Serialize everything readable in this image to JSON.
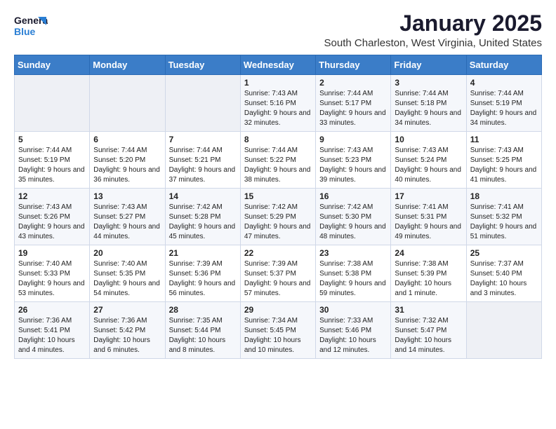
{
  "logo": {
    "line1": "General",
    "line2": "Blue"
  },
  "title": "January 2025",
  "subtitle": "South Charleston, West Virginia, United States",
  "days_of_week": [
    "Sunday",
    "Monday",
    "Tuesday",
    "Wednesday",
    "Thursday",
    "Friday",
    "Saturday"
  ],
  "weeks": [
    [
      {
        "day": "",
        "info": ""
      },
      {
        "day": "",
        "info": ""
      },
      {
        "day": "",
        "info": ""
      },
      {
        "day": "1",
        "info": "Sunrise: 7:43 AM\nSunset: 5:16 PM\nDaylight: 9 hours and 32 minutes."
      },
      {
        "day": "2",
        "info": "Sunrise: 7:44 AM\nSunset: 5:17 PM\nDaylight: 9 hours and 33 minutes."
      },
      {
        "day": "3",
        "info": "Sunrise: 7:44 AM\nSunset: 5:18 PM\nDaylight: 9 hours and 34 minutes."
      },
      {
        "day": "4",
        "info": "Sunrise: 7:44 AM\nSunset: 5:19 PM\nDaylight: 9 hours and 34 minutes."
      }
    ],
    [
      {
        "day": "5",
        "info": "Sunrise: 7:44 AM\nSunset: 5:19 PM\nDaylight: 9 hours and 35 minutes."
      },
      {
        "day": "6",
        "info": "Sunrise: 7:44 AM\nSunset: 5:20 PM\nDaylight: 9 hours and 36 minutes."
      },
      {
        "day": "7",
        "info": "Sunrise: 7:44 AM\nSunset: 5:21 PM\nDaylight: 9 hours and 37 minutes."
      },
      {
        "day": "8",
        "info": "Sunrise: 7:44 AM\nSunset: 5:22 PM\nDaylight: 9 hours and 38 minutes."
      },
      {
        "day": "9",
        "info": "Sunrise: 7:43 AM\nSunset: 5:23 PM\nDaylight: 9 hours and 39 minutes."
      },
      {
        "day": "10",
        "info": "Sunrise: 7:43 AM\nSunset: 5:24 PM\nDaylight: 9 hours and 40 minutes."
      },
      {
        "day": "11",
        "info": "Sunrise: 7:43 AM\nSunset: 5:25 PM\nDaylight: 9 hours and 41 minutes."
      }
    ],
    [
      {
        "day": "12",
        "info": "Sunrise: 7:43 AM\nSunset: 5:26 PM\nDaylight: 9 hours and 43 minutes."
      },
      {
        "day": "13",
        "info": "Sunrise: 7:43 AM\nSunset: 5:27 PM\nDaylight: 9 hours and 44 minutes."
      },
      {
        "day": "14",
        "info": "Sunrise: 7:42 AM\nSunset: 5:28 PM\nDaylight: 9 hours and 45 minutes."
      },
      {
        "day": "15",
        "info": "Sunrise: 7:42 AM\nSunset: 5:29 PM\nDaylight: 9 hours and 47 minutes."
      },
      {
        "day": "16",
        "info": "Sunrise: 7:42 AM\nSunset: 5:30 PM\nDaylight: 9 hours and 48 minutes."
      },
      {
        "day": "17",
        "info": "Sunrise: 7:41 AM\nSunset: 5:31 PM\nDaylight: 9 hours and 49 minutes."
      },
      {
        "day": "18",
        "info": "Sunrise: 7:41 AM\nSunset: 5:32 PM\nDaylight: 9 hours and 51 minutes."
      }
    ],
    [
      {
        "day": "19",
        "info": "Sunrise: 7:40 AM\nSunset: 5:33 PM\nDaylight: 9 hours and 53 minutes."
      },
      {
        "day": "20",
        "info": "Sunrise: 7:40 AM\nSunset: 5:35 PM\nDaylight: 9 hours and 54 minutes."
      },
      {
        "day": "21",
        "info": "Sunrise: 7:39 AM\nSunset: 5:36 PM\nDaylight: 9 hours and 56 minutes."
      },
      {
        "day": "22",
        "info": "Sunrise: 7:39 AM\nSunset: 5:37 PM\nDaylight: 9 hours and 57 minutes."
      },
      {
        "day": "23",
        "info": "Sunrise: 7:38 AM\nSunset: 5:38 PM\nDaylight: 9 hours and 59 minutes."
      },
      {
        "day": "24",
        "info": "Sunrise: 7:38 AM\nSunset: 5:39 PM\nDaylight: 10 hours and 1 minute."
      },
      {
        "day": "25",
        "info": "Sunrise: 7:37 AM\nSunset: 5:40 PM\nDaylight: 10 hours and 3 minutes."
      }
    ],
    [
      {
        "day": "26",
        "info": "Sunrise: 7:36 AM\nSunset: 5:41 PM\nDaylight: 10 hours and 4 minutes."
      },
      {
        "day": "27",
        "info": "Sunrise: 7:36 AM\nSunset: 5:42 PM\nDaylight: 10 hours and 6 minutes."
      },
      {
        "day": "28",
        "info": "Sunrise: 7:35 AM\nSunset: 5:44 PM\nDaylight: 10 hours and 8 minutes."
      },
      {
        "day": "29",
        "info": "Sunrise: 7:34 AM\nSunset: 5:45 PM\nDaylight: 10 hours and 10 minutes."
      },
      {
        "day": "30",
        "info": "Sunrise: 7:33 AM\nSunset: 5:46 PM\nDaylight: 10 hours and 12 minutes."
      },
      {
        "day": "31",
        "info": "Sunrise: 7:32 AM\nSunset: 5:47 PM\nDaylight: 10 hours and 14 minutes."
      },
      {
        "day": "",
        "info": ""
      }
    ]
  ]
}
